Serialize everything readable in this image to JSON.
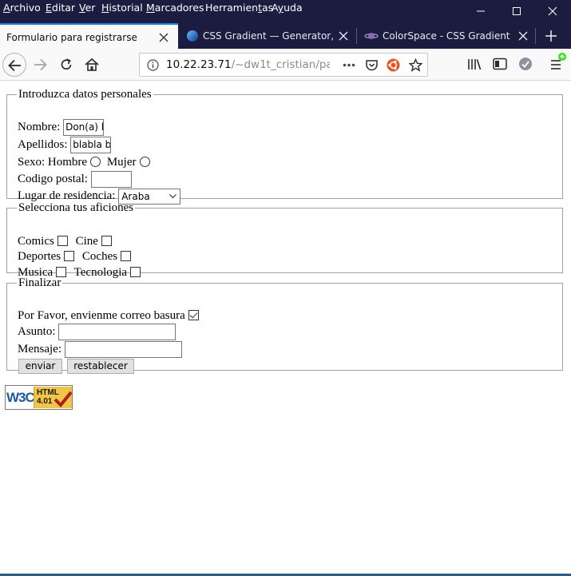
{
  "menubar": {
    "items": [
      {
        "pre": "",
        "accel": "A",
        "post": "rchivo"
      },
      {
        "pre": "",
        "accel": "E",
        "post": "ditar"
      },
      {
        "pre": "",
        "accel": "V",
        "post": "er"
      },
      {
        "pre": "",
        "accel": "H",
        "post": "istorial"
      },
      {
        "pre": "",
        "accel": "M",
        "post": "arcadores"
      },
      {
        "pre": "Herramien",
        "accel": "t",
        "post": "as"
      },
      {
        "pre": "A",
        "accel": "y",
        "post": "uda"
      }
    ]
  },
  "tabs": [
    {
      "title": "Formulario para registrarse",
      "active": true
    },
    {
      "title": "CSS Gradient — Generator, Maker",
      "active": false
    },
    {
      "title": "ColorSpace - CSS Gradient Color",
      "active": false
    }
  ],
  "urlbar": {
    "host": "10.22.23.71",
    "path": "/~dw1t_cristian/pa"
  },
  "form": {
    "personal": {
      "legend": "Introduzca datos personales",
      "nombre_label": "Nombre:",
      "nombre_value": "Don(a) l",
      "apellidos_label": "Apellidos:",
      "apellidos_value": "blabla b",
      "sexo_label": "Sexo:",
      "hombre_label": "Hombre",
      "mujer_label": "Mujer",
      "cp_label": "Codigo postal:",
      "cp_value": "",
      "residencia_label": "Lugar de residencia:",
      "residencia_value": "Araba"
    },
    "aficiones": {
      "legend": "Selecciona tus aficiones",
      "items": [
        "Comics",
        "Cine",
        "Deportes",
        "Coches",
        "Musica",
        "Tecnologia"
      ]
    },
    "finalizar": {
      "legend": "Finalizar",
      "spam_label": "Por Favor, envienme correo basura",
      "spam_checked": true,
      "asunto_label": "Asunto:",
      "asunto_value": "",
      "mensaje_label": "Mensaje:",
      "mensaje_value": "",
      "submit_label": "enviar",
      "reset_label": "restablecer"
    }
  },
  "badge": {
    "left": "W3C",
    "line1": "HTML",
    "line2": "4.01"
  },
  "colors": {
    "titlebar": "#1c1c40",
    "active_tab_accent": "#0a84ff",
    "badge_yellow": "#f1c545"
  }
}
